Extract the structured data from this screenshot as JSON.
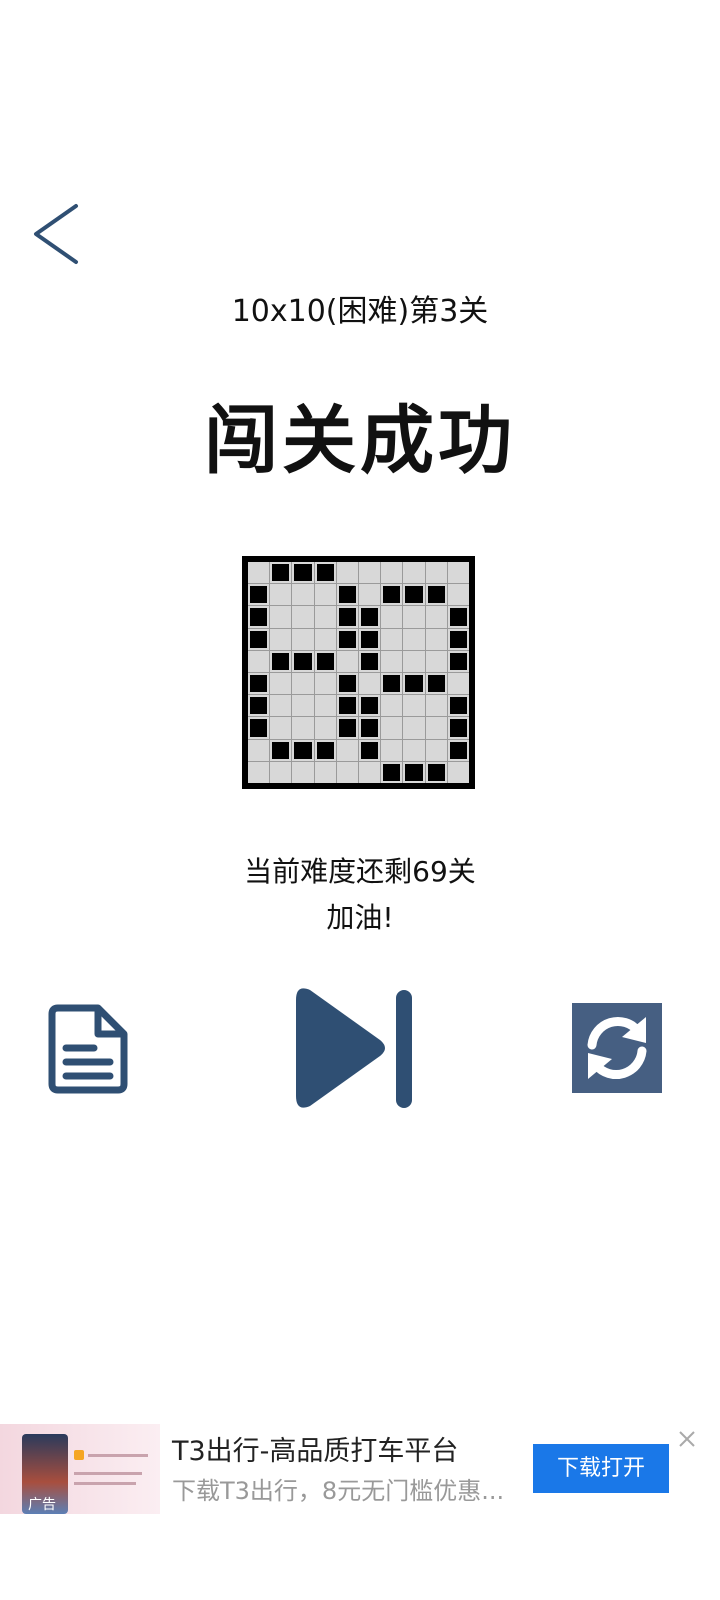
{
  "header": {
    "back_icon": "chevron-left-icon",
    "level_title": "10x10(困难)第3关",
    "result_title": "闯关成功"
  },
  "puzzle": {
    "rows": 10,
    "cols": 10,
    "grid": [
      [
        0,
        1,
        1,
        1,
        0,
        0,
        0,
        0,
        0,
        0
      ],
      [
        1,
        0,
        0,
        0,
        1,
        0,
        1,
        1,
        1,
        0
      ],
      [
        1,
        0,
        0,
        0,
        1,
        1,
        0,
        0,
        0,
        1
      ],
      [
        1,
        0,
        0,
        0,
        1,
        1,
        0,
        0,
        0,
        1
      ],
      [
        0,
        1,
        1,
        1,
        0,
        1,
        0,
        0,
        0,
        1
      ],
      [
        1,
        0,
        0,
        0,
        1,
        0,
        1,
        1,
        1,
        0
      ],
      [
        1,
        0,
        0,
        0,
        1,
        1,
        0,
        0,
        0,
        1
      ],
      [
        1,
        0,
        0,
        0,
        1,
        1,
        0,
        0,
        0,
        1
      ],
      [
        0,
        1,
        1,
        1,
        0,
        1,
        0,
        0,
        0,
        1
      ],
      [
        0,
        0,
        0,
        0,
        0,
        0,
        1,
        1,
        1,
        0
      ]
    ]
  },
  "status": {
    "remaining_text": "当前难度还剩69关",
    "cheer_text": "加油!"
  },
  "actions": {
    "doc_icon": "document-icon",
    "next_icon": "skip-next-icon",
    "refresh_icon": "refresh-icon",
    "color": "#2f4f73"
  },
  "ad": {
    "title": "T3出行-高品质打车平台",
    "description": "下载T3出行，8元无门槛优惠...",
    "download_label": "下载打开",
    "tag": "广告",
    "button_color": "#1a78e8",
    "close_icon": "close-icon"
  }
}
